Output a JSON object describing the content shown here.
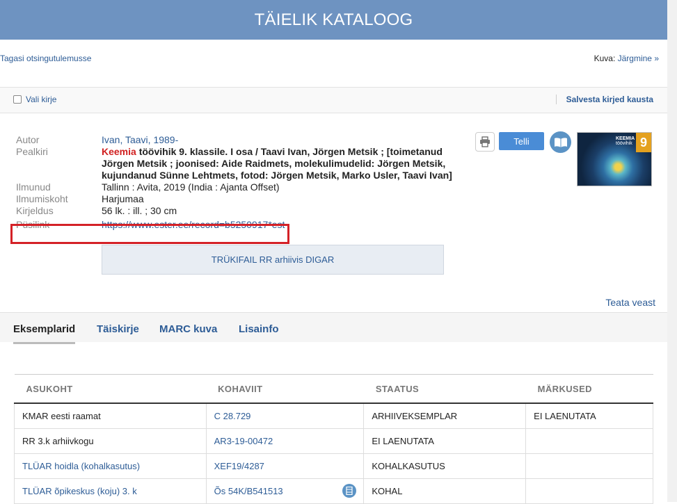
{
  "header": {
    "title": "TÄIELIK KATALOOG"
  },
  "nav": {
    "back_label": "Tagasi otsingutulemusse",
    "view_label": "Kuva:",
    "next_label": "Järgmine »"
  },
  "toolbar": {
    "select_label": "Vali kirje",
    "save_label": "Salvesta kirjed kausta"
  },
  "record": {
    "author_key": "Autor",
    "author": "Ivan, Taavi, 1989-",
    "title_key": "Pealkiri",
    "title_highlight": "Keemia",
    "title_rest": " töövihik 9. klassile. I osa / Taavi Ivan, Jörgen Metsik ; [toimetanud Jörgen Metsik ; joonised: Aide Raidmets, molekulimudelid: Jörgen Metsik, kujundanud Sünne Lehtmets, fotod: Jörgen Metsik, Marko Usler, Taavi Ivan]",
    "published_key": "Ilmunud",
    "published": "Tallinn : Avita, 2019 (India : Ajanta Offset)",
    "place_key": "Ilmumiskoht",
    "place": "Harjumaa",
    "desc_key": "Kirjeldus",
    "desc": "56 lk. : ill. ; 30 cm",
    "permalink_key": "Püsilink",
    "permalink": "https://www.ester.ee/record=b5250917*est",
    "digar_label": "TRÜKIFAIL RR arhiivis DIGAR"
  },
  "actions": {
    "order_label": "Telli"
  },
  "cover": {
    "title": "KEEMIA",
    "subtitle": "töövihik",
    "number": "9"
  },
  "report_label": "Teata veast",
  "tabs": [
    {
      "label": "Eksemplarid"
    },
    {
      "label": "Täiskirje"
    },
    {
      "label": "MARC kuva"
    },
    {
      "label": "Lisainfo"
    }
  ],
  "holdings": {
    "headers": [
      "ASUKOHT",
      "KOHAVIIT",
      "STAATUS",
      "MÄRKUSED"
    ],
    "rows": [
      {
        "location": "KMAR eesti raamat",
        "callno": "C 28.729",
        "status": "ARHIIVEKSEMPLAR",
        "note": "EI LAENUTATA"
      },
      {
        "location": "RR 3.k arhiivkogu",
        "callno": "AR3-19-00472",
        "status": "EI LAENUTATA",
        "note": ""
      },
      {
        "location": "TLÜAR hoidla (kohalkasutus)",
        "callno": "XEF19/4287",
        "status": "KOHALKASUTUS",
        "note": ""
      },
      {
        "location": "TLÜAR õpikeskus (koju) 3. k",
        "callno": "Õs 54K/B541513",
        "status": "KOHAL",
        "note": ""
      }
    ]
  },
  "colors": {
    "header_bg": "#6e93c1",
    "link": "#2d5c96",
    "highlight": "#d02020",
    "button": "#4a8cd6",
    "frame": "#d42127"
  }
}
